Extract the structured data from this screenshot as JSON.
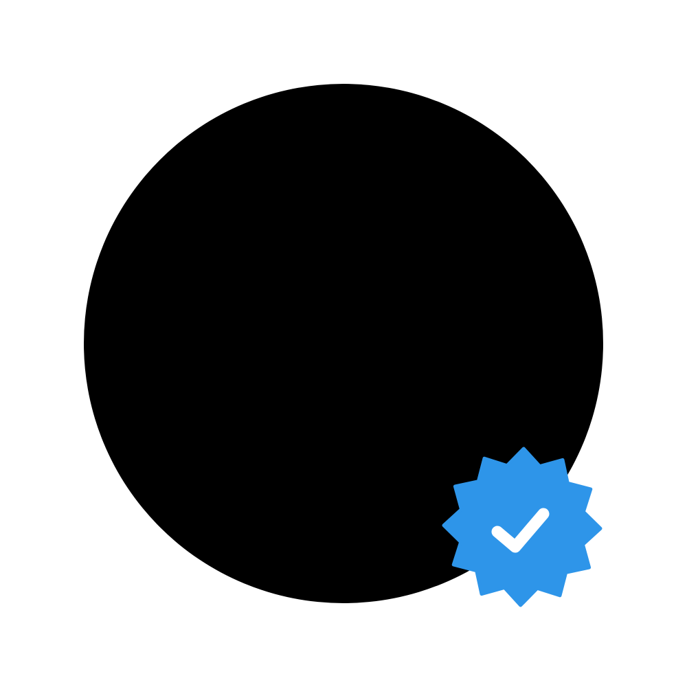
{
  "avatar": {
    "shape": "circle",
    "color": "#000000"
  },
  "badge": {
    "icon": "verified-check-badge-icon",
    "badge_color": "#2e95e9",
    "check_color": "#ffffff",
    "points": 12
  },
  "colors": {
    "background": "#ffffff"
  }
}
